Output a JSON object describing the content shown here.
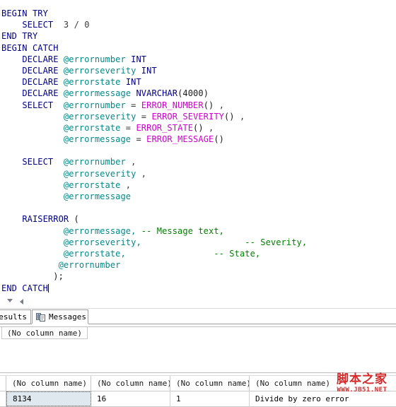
{
  "editor": {
    "name": "sql-query-editor",
    "language": "T-SQL",
    "caret_after": "END CATCH",
    "colors": {
      "keyword": "#00008b",
      "variable": "#008a8a",
      "function": "#d100d1",
      "comment": "#008000",
      "plain": "#1a1a1a",
      "background": "#ffffff"
    },
    "lines": [
      {
        "indent": 0,
        "tokens": [
          {
            "t": "BEGIN TRY",
            "c": "kw"
          }
        ]
      },
      {
        "indent": 4,
        "tokens": [
          {
            "t": "SELECT",
            "c": "kw"
          },
          {
            "t": "  3 / 0",
            "c": "num"
          }
        ]
      },
      {
        "indent": 0,
        "tokens": [
          {
            "t": "END TRY",
            "c": "kw"
          }
        ]
      },
      {
        "indent": 0,
        "tokens": [
          {
            "t": "BEGIN CATCH",
            "c": "kw"
          }
        ]
      },
      {
        "indent": 4,
        "tokens": [
          {
            "t": "DECLARE ",
            "c": "kw"
          },
          {
            "t": "@errornumber",
            "c": "var"
          },
          {
            "t": " INT",
            "c": "kw"
          }
        ]
      },
      {
        "indent": 4,
        "tokens": [
          {
            "t": "DECLARE ",
            "c": "kw"
          },
          {
            "t": "@errorseverity",
            "c": "var"
          },
          {
            "t": " INT",
            "c": "kw"
          }
        ]
      },
      {
        "indent": 4,
        "tokens": [
          {
            "t": "DECLARE ",
            "c": "kw"
          },
          {
            "t": "@errorstate",
            "c": "var"
          },
          {
            "t": " INT",
            "c": "kw"
          }
        ]
      },
      {
        "indent": 4,
        "tokens": [
          {
            "t": "DECLARE ",
            "c": "kw"
          },
          {
            "t": "@errormessage",
            "c": "var"
          },
          {
            "t": " NVARCHAR",
            "c": "kw"
          },
          {
            "t": "(4000)",
            "c": "plain"
          }
        ]
      },
      {
        "indent": 4,
        "tokens": [
          {
            "t": "SELECT",
            "c": "kw"
          },
          {
            "t": "  ",
            "c": "plain"
          },
          {
            "t": "@errornumber",
            "c": "var"
          },
          {
            "t": " = ",
            "c": "op"
          },
          {
            "t": "ERROR_NUMBER",
            "c": "fn"
          },
          {
            "t": "()",
            "c": "plain"
          },
          {
            "t": " ,",
            "c": "op"
          }
        ]
      },
      {
        "indent": 12,
        "tokens": [
          {
            "t": "@errorseverity",
            "c": "var"
          },
          {
            "t": " = ",
            "c": "op"
          },
          {
            "t": "ERROR_SEVERITY",
            "c": "fn"
          },
          {
            "t": "()",
            "c": "plain"
          },
          {
            "t": " ,",
            "c": "op"
          }
        ]
      },
      {
        "indent": 12,
        "tokens": [
          {
            "t": "@errorstate",
            "c": "var"
          },
          {
            "t": " = ",
            "c": "op"
          },
          {
            "t": "ERROR_STATE",
            "c": "fn"
          },
          {
            "t": "()",
            "c": "plain"
          },
          {
            "t": " ,",
            "c": "op"
          }
        ]
      },
      {
        "indent": 12,
        "tokens": [
          {
            "t": "@errormessage",
            "c": "var"
          },
          {
            "t": " = ",
            "c": "op"
          },
          {
            "t": "ERROR_MESSAGE",
            "c": "fn"
          },
          {
            "t": "()",
            "c": "plain"
          }
        ]
      },
      {
        "indent": 0,
        "tokens": []
      },
      {
        "indent": 4,
        "tokens": [
          {
            "t": "SELECT",
            "c": "kw"
          },
          {
            "t": "  ",
            "c": "plain"
          },
          {
            "t": "@errornumber",
            "c": "var"
          },
          {
            "t": " ,",
            "c": "op"
          }
        ]
      },
      {
        "indent": 12,
        "tokens": [
          {
            "t": "@errorseverity",
            "c": "var"
          },
          {
            "t": " ,",
            "c": "op"
          }
        ]
      },
      {
        "indent": 12,
        "tokens": [
          {
            "t": "@errorstate",
            "c": "var"
          },
          {
            "t": " ,",
            "c": "op"
          }
        ]
      },
      {
        "indent": 12,
        "tokens": [
          {
            "t": "@errormessage",
            "c": "var"
          }
        ]
      },
      {
        "indent": 0,
        "tokens": []
      },
      {
        "indent": 4,
        "tokens": [
          {
            "t": "RAISERROR",
            "c": "kw"
          },
          {
            "t": " (",
            "c": "plain"
          }
        ]
      },
      {
        "indent": 12,
        "tokens": [
          {
            "t": "@errormessage,",
            "c": "var"
          },
          {
            "t": " -- Message text,",
            "c": "cmt"
          }
        ]
      },
      {
        "indent": 12,
        "tokens": [
          {
            "t": "@errorseverity,",
            "c": "var"
          },
          {
            "t": "                    -- Severity,",
            "c": "cmt"
          }
        ]
      },
      {
        "indent": 12,
        "tokens": [
          {
            "t": "@errorstate,",
            "c": "var"
          },
          {
            "t": "                 -- State,",
            "c": "cmt"
          }
        ]
      },
      {
        "indent": 11,
        "tokens": [
          {
            "t": "@errornumber",
            "c": "var"
          }
        ]
      },
      {
        "indent": 10,
        "tokens": [
          {
            "t": ");",
            "c": "plain"
          }
        ]
      },
      {
        "indent": 0,
        "tokens": [
          {
            "t": "END CATCH",
            "c": "kw"
          },
          {
            "t": "__CARET__",
            "c": "caret"
          }
        ]
      }
    ]
  },
  "hscrollbar": {
    "name": "editor-horizontal-scrollbar",
    "down_arrow": "scroll-down-arrow",
    "left_arrow": "scroll-left-arrow"
  },
  "result_tabs": {
    "active": "Results",
    "items": [
      {
        "label": "Results",
        "icon": "grid-icon",
        "active": true,
        "clipped": true
      },
      {
        "label": "Messages",
        "icon": "messages-icon",
        "active": false,
        "clipped": false
      }
    ]
  },
  "middle_result": {
    "name": "first-result-set",
    "header": "(No column name)"
  },
  "bottom_result": {
    "name": "second-result-set",
    "columns": [
      "(No column name)",
      "(No column name)",
      "(No column name)",
      "(No column name)"
    ],
    "rows": [
      [
        "8134",
        "16",
        "1",
        "Divide by zero error"
      ]
    ],
    "selected_cell": {
      "row": 0,
      "col": 0
    }
  },
  "watermark": {
    "chinese": "脚本之家",
    "url": "WWW.JB51.NET",
    "color": "#d42a2a"
  }
}
